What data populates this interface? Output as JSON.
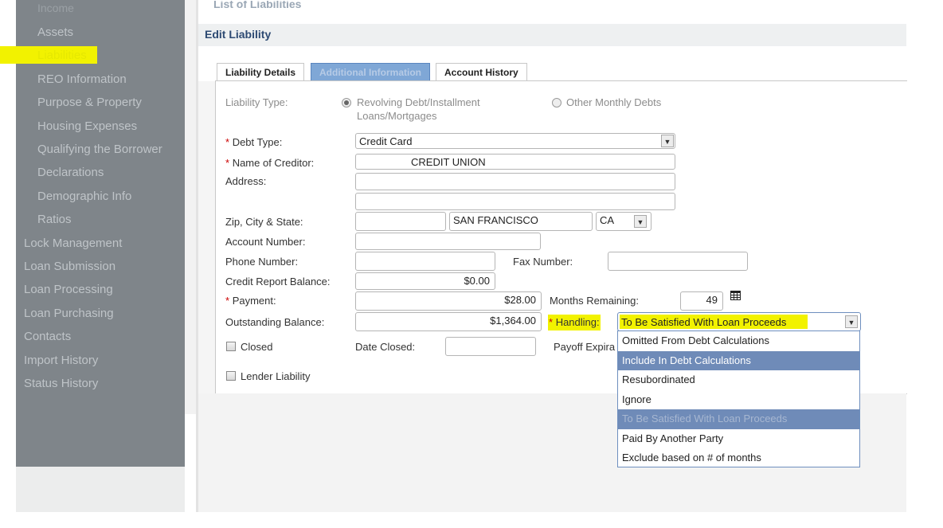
{
  "sidebar": {
    "items": [
      {
        "label": "Income"
      },
      {
        "label": "Assets"
      },
      {
        "label": "Liabilities"
      },
      {
        "label": "REO Information"
      },
      {
        "label": "Purpose & Property"
      },
      {
        "label": "Housing Expenses"
      },
      {
        "label": "Qualifying the Borrower"
      },
      {
        "label": "Declarations"
      },
      {
        "label": "Demographic Info"
      },
      {
        "label": "Ratios"
      },
      {
        "label": "Lock Management"
      },
      {
        "label": "Loan Submission"
      },
      {
        "label": "Loan Processing"
      },
      {
        "label": "Loan Purchasing"
      },
      {
        "label": "Contacts"
      },
      {
        "label": "Import History"
      },
      {
        "label": "Status History"
      }
    ]
  },
  "header": {
    "top_title": "List of Liabilities",
    "title": "Edit Liability"
  },
  "tabs": [
    {
      "label": "Liability Details"
    },
    {
      "label": "Additional Information"
    },
    {
      "label": "Account History"
    }
  ],
  "form": {
    "liability_type_label": "Liability Type:",
    "liability_type_options": [
      "Revolving Debt/Installment",
      "Loans/Mortgages",
      "Other Monthly Debts"
    ],
    "debt_type_label": "Debt Type:",
    "debt_type_value": "Credit Card",
    "creditor_label": "Name of Creditor:",
    "creditor_value": "CREDIT UNION",
    "address_label": "Address:",
    "zip_label": "Zip, City & State:",
    "city_value": "SAN FRANCISCO",
    "state_value": "CA",
    "account_label": "Account Number:",
    "phone_label": "Phone Number:",
    "fax_label": "Fax Number:",
    "credit_balance_label": "Credit Report Balance:",
    "credit_balance_value": "$0.00",
    "payment_label": "Payment:",
    "payment_value": "$28.00",
    "months_label": "Months Remaining:",
    "months_value": "49",
    "outstanding_label": "Outstanding Balance:",
    "outstanding_value": "$1,364.00",
    "handling_label": "Handling:",
    "handling_value": "To Be Satisfied With Loan Proceeds",
    "closed_label": "Closed",
    "date_closed_label": "Date Closed:",
    "payoff_label": "Payoff Expira",
    "lender_liability_label": "Lender Liability",
    "required_mark": "*"
  },
  "handling_options": [
    "Omitted From Debt Calculations",
    "Include In Debt Calculations",
    "Resubordinated",
    "Ignore",
    "To Be Satisfied With Loan Proceeds",
    "Paid By Another Party",
    "Exclude based on # of months"
  ],
  "colors": {
    "highlight": "#f2f200",
    "sidebar": "#7f858a",
    "selection": "#6f8bb8"
  }
}
